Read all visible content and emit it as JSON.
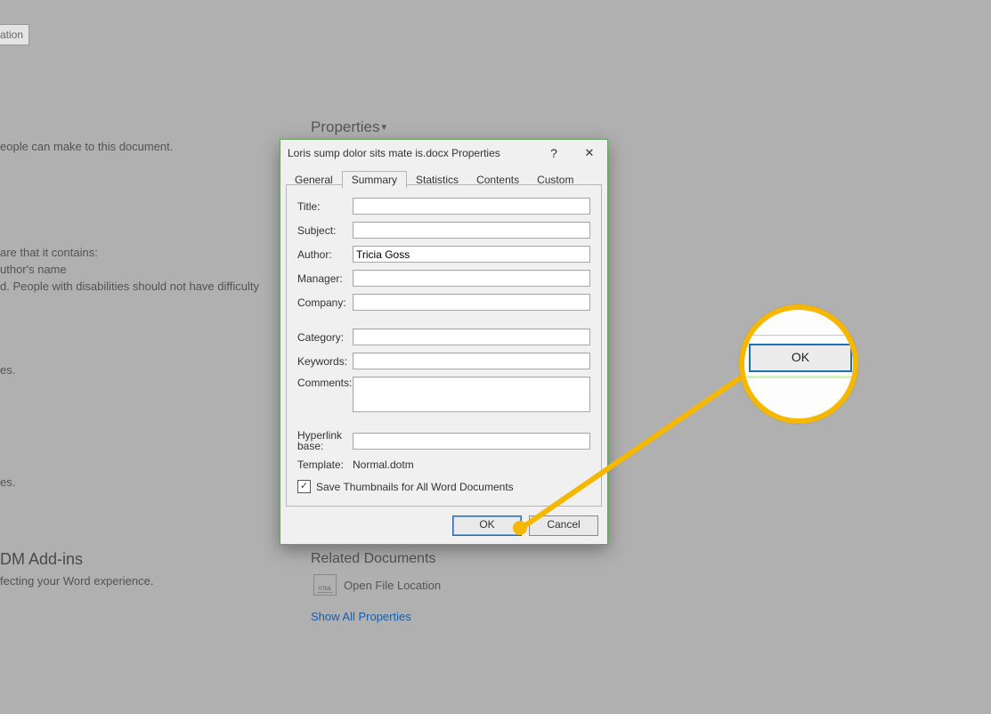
{
  "background": {
    "top_button_fragment": "ation",
    "frag1": "eople can make to this document.",
    "frag2": "are that it contains:",
    "frag3": "uthor's name",
    "frag4": "d. People with disabilities should not have difficulty",
    "frag5": "es.",
    "frag6": "es.",
    "properties_heading": "Properties",
    "related_docs_heading": "Related Documents",
    "open_file_location": "Open File Location",
    "file_icon_text": "HTML",
    "show_all_properties": "Show All Properties",
    "addins_heading": "DM Add-ins",
    "addins_sub": "fecting your Word experience."
  },
  "dialog": {
    "title": "Loris sump dolor sits mate is.docx Properties",
    "help_symbol": "?",
    "close_symbol": "✕",
    "tabs": {
      "general": "General",
      "summary": "Summary",
      "statistics": "Statistics",
      "contents": "Contents",
      "custom": "Custom"
    },
    "labels": {
      "title": "Title:",
      "subject": "Subject:",
      "author": "Author:",
      "manager": "Manager:",
      "company": "Company:",
      "category": "Category:",
      "keywords": "Keywords:",
      "comments": "Comments:",
      "hyperlink_base": "Hyperlink base:",
      "template": "Template:"
    },
    "values": {
      "title": "",
      "subject": "",
      "author": "Tricia Goss",
      "manager": "",
      "company": "",
      "category": "",
      "keywords": "",
      "comments": "",
      "hyperlink_base": "",
      "template": "Normal.dotm"
    },
    "checkbox": {
      "checked_glyph": "✓",
      "label": "Save Thumbnails for All Word Documents"
    },
    "buttons": {
      "ok": "OK",
      "cancel": "Cancel"
    }
  },
  "magnifier": {
    "ok": "OK"
  }
}
